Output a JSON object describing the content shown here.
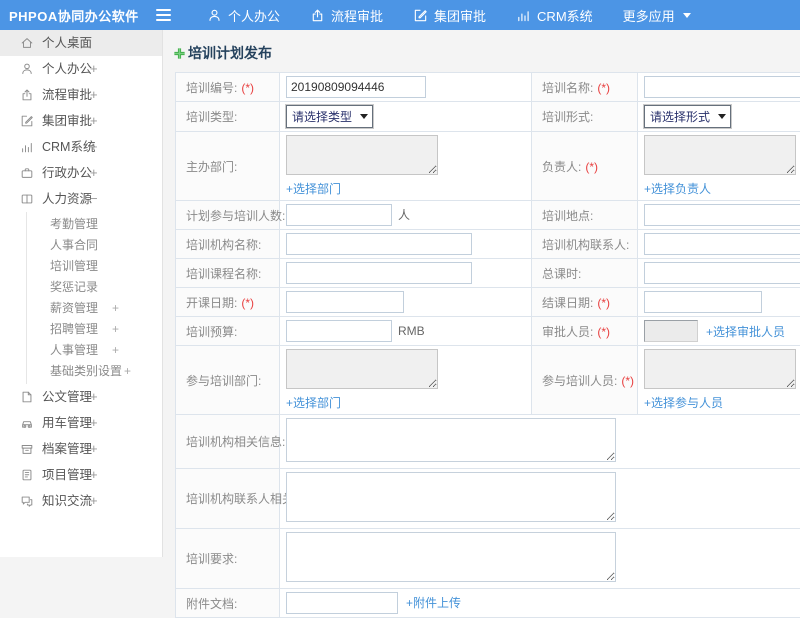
{
  "header": {
    "brand": "PHPOA协同办公软件",
    "nav": [
      {
        "label": "个人办公"
      },
      {
        "label": "流程审批"
      },
      {
        "label": "集团审批"
      },
      {
        "label": "CRM系统"
      },
      {
        "label": "更多应用"
      }
    ]
  },
  "sidebar": {
    "items": [
      {
        "label": "个人桌面"
      },
      {
        "label": "个人办公",
        "expander": "+"
      },
      {
        "label": "流程审批",
        "expander": "+"
      },
      {
        "label": "集团审批",
        "expander": "+"
      },
      {
        "label": "CRM系统",
        "expander": "+"
      },
      {
        "label": "行政办公",
        "expander": "+"
      },
      {
        "label": "人力资源",
        "expander": "−"
      },
      {
        "label": "公文管理",
        "expander": "+"
      },
      {
        "label": "用车管理",
        "expander": "+"
      },
      {
        "label": "档案管理",
        "expander": "+"
      },
      {
        "label": "项目管理",
        "expander": "+"
      },
      {
        "label": "知识交流",
        "expander": "+"
      }
    ],
    "hr_children": [
      {
        "label": "考勤管理"
      },
      {
        "label": "人事合同"
      },
      {
        "label": "培训管理"
      },
      {
        "label": "奖惩记录"
      },
      {
        "label": "薪资管理",
        "expander": "+"
      },
      {
        "label": "招聘管理",
        "expander": "+"
      },
      {
        "label": "人事管理",
        "expander": "+"
      },
      {
        "label": "基础类别设置",
        "expander": "+"
      }
    ]
  },
  "form": {
    "title": "培训计划发布",
    "required_mark": "(*)",
    "fields": {
      "training_no": {
        "label": "培训编号:",
        "value": "20190809094446"
      },
      "training_name": {
        "label": "培训名称:"
      },
      "training_type": {
        "label": "培训类型:",
        "placeholder": "请选择类型"
      },
      "training_mode": {
        "label": "培训形式:",
        "placeholder": "请选择形式"
      },
      "host_dept": {
        "label": "主办部门:",
        "link": "+选择部门"
      },
      "leader": {
        "label": "负责人:",
        "link": "+选择负责人"
      },
      "planned_count": {
        "label": "计划参与培训人数:",
        "unit": "人"
      },
      "location": {
        "label": "培训地点:"
      },
      "org_name": {
        "label": "培训机构名称:"
      },
      "org_contact": {
        "label": "培训机构联系人:"
      },
      "course_name": {
        "label": "培训课程名称:"
      },
      "total_hours": {
        "label": "总课时:"
      },
      "start_date": {
        "label": "开课日期:"
      },
      "end_date": {
        "label": "结课日期:"
      },
      "budget": {
        "label": "培训预算:",
        "unit": "RMB"
      },
      "approver": {
        "label": "审批人员:",
        "link": "+选择审批人员"
      },
      "join_dept": {
        "label": "参与培训部门:",
        "link": "+选择部门"
      },
      "join_people": {
        "label": "参与培训人员:",
        "link": "+选择参与人员"
      },
      "org_info": {
        "label": "培训机构相关信息:"
      },
      "org_contact_info": {
        "label": "培训机构联系人相关信息:"
      },
      "requirements": {
        "label": "培训要求:"
      },
      "attachment": {
        "label": "附件文档:",
        "link": "+附件上传"
      }
    }
  },
  "colors": {
    "header_bg": "#4c95e5",
    "link_blue": "#4492d8",
    "required_red": "#e84040",
    "title_green_plus": "#3fae49"
  }
}
